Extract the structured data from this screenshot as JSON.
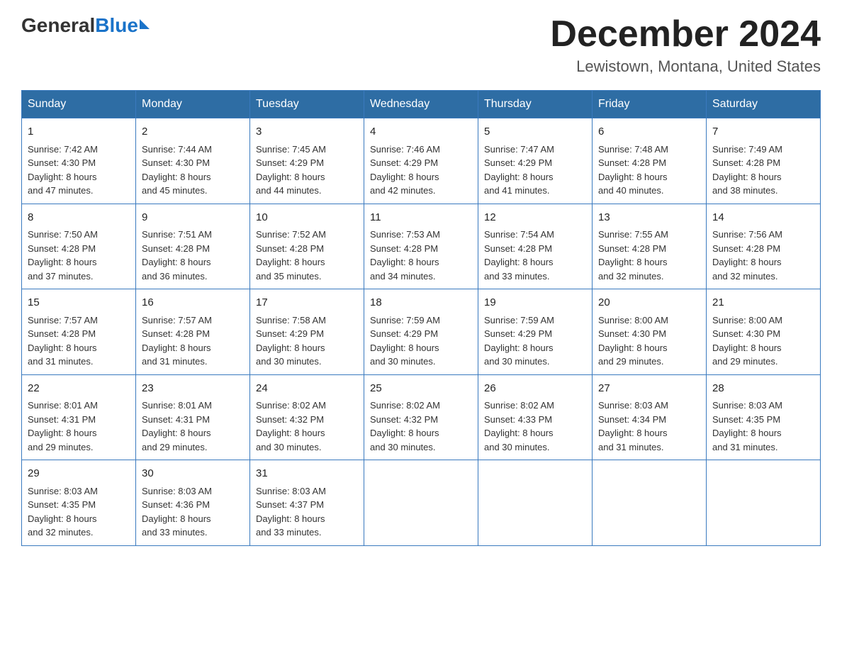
{
  "logo": {
    "general": "General",
    "blue": "Blue"
  },
  "title": "December 2024",
  "location": "Lewistown, Montana, United States",
  "days_of_week": [
    "Sunday",
    "Monday",
    "Tuesday",
    "Wednesday",
    "Thursday",
    "Friday",
    "Saturday"
  ],
  "weeks": [
    [
      {
        "day": "1",
        "sunrise": "7:42 AM",
        "sunset": "4:30 PM",
        "daylight": "8 hours and 47 minutes."
      },
      {
        "day": "2",
        "sunrise": "7:44 AM",
        "sunset": "4:30 PM",
        "daylight": "8 hours and 45 minutes."
      },
      {
        "day": "3",
        "sunrise": "7:45 AM",
        "sunset": "4:29 PM",
        "daylight": "8 hours and 44 minutes."
      },
      {
        "day": "4",
        "sunrise": "7:46 AM",
        "sunset": "4:29 PM",
        "daylight": "8 hours and 42 minutes."
      },
      {
        "day": "5",
        "sunrise": "7:47 AM",
        "sunset": "4:29 PM",
        "daylight": "8 hours and 41 minutes."
      },
      {
        "day": "6",
        "sunrise": "7:48 AM",
        "sunset": "4:28 PM",
        "daylight": "8 hours and 40 minutes."
      },
      {
        "day": "7",
        "sunrise": "7:49 AM",
        "sunset": "4:28 PM",
        "daylight": "8 hours and 38 minutes."
      }
    ],
    [
      {
        "day": "8",
        "sunrise": "7:50 AM",
        "sunset": "4:28 PM",
        "daylight": "8 hours and 37 minutes."
      },
      {
        "day": "9",
        "sunrise": "7:51 AM",
        "sunset": "4:28 PM",
        "daylight": "8 hours and 36 minutes."
      },
      {
        "day": "10",
        "sunrise": "7:52 AM",
        "sunset": "4:28 PM",
        "daylight": "8 hours and 35 minutes."
      },
      {
        "day": "11",
        "sunrise": "7:53 AM",
        "sunset": "4:28 PM",
        "daylight": "8 hours and 34 minutes."
      },
      {
        "day": "12",
        "sunrise": "7:54 AM",
        "sunset": "4:28 PM",
        "daylight": "8 hours and 33 minutes."
      },
      {
        "day": "13",
        "sunrise": "7:55 AM",
        "sunset": "4:28 PM",
        "daylight": "8 hours and 32 minutes."
      },
      {
        "day": "14",
        "sunrise": "7:56 AM",
        "sunset": "4:28 PM",
        "daylight": "8 hours and 32 minutes."
      }
    ],
    [
      {
        "day": "15",
        "sunrise": "7:57 AM",
        "sunset": "4:28 PM",
        "daylight": "8 hours and 31 minutes."
      },
      {
        "day": "16",
        "sunrise": "7:57 AM",
        "sunset": "4:28 PM",
        "daylight": "8 hours and 31 minutes."
      },
      {
        "day": "17",
        "sunrise": "7:58 AM",
        "sunset": "4:29 PM",
        "daylight": "8 hours and 30 minutes."
      },
      {
        "day": "18",
        "sunrise": "7:59 AM",
        "sunset": "4:29 PM",
        "daylight": "8 hours and 30 minutes."
      },
      {
        "day": "19",
        "sunrise": "7:59 AM",
        "sunset": "4:29 PM",
        "daylight": "8 hours and 30 minutes."
      },
      {
        "day": "20",
        "sunrise": "8:00 AM",
        "sunset": "4:30 PM",
        "daylight": "8 hours and 29 minutes."
      },
      {
        "day": "21",
        "sunrise": "8:00 AM",
        "sunset": "4:30 PM",
        "daylight": "8 hours and 29 minutes."
      }
    ],
    [
      {
        "day": "22",
        "sunrise": "8:01 AM",
        "sunset": "4:31 PM",
        "daylight": "8 hours and 29 minutes."
      },
      {
        "day": "23",
        "sunrise": "8:01 AM",
        "sunset": "4:31 PM",
        "daylight": "8 hours and 29 minutes."
      },
      {
        "day": "24",
        "sunrise": "8:02 AM",
        "sunset": "4:32 PM",
        "daylight": "8 hours and 30 minutes."
      },
      {
        "day": "25",
        "sunrise": "8:02 AM",
        "sunset": "4:32 PM",
        "daylight": "8 hours and 30 minutes."
      },
      {
        "day": "26",
        "sunrise": "8:02 AM",
        "sunset": "4:33 PM",
        "daylight": "8 hours and 30 minutes."
      },
      {
        "day": "27",
        "sunrise": "8:03 AM",
        "sunset": "4:34 PM",
        "daylight": "8 hours and 31 minutes."
      },
      {
        "day": "28",
        "sunrise": "8:03 AM",
        "sunset": "4:35 PM",
        "daylight": "8 hours and 31 minutes."
      }
    ],
    [
      {
        "day": "29",
        "sunrise": "8:03 AM",
        "sunset": "4:35 PM",
        "daylight": "8 hours and 32 minutes."
      },
      {
        "day": "30",
        "sunrise": "8:03 AM",
        "sunset": "4:36 PM",
        "daylight": "8 hours and 33 minutes."
      },
      {
        "day": "31",
        "sunrise": "8:03 AM",
        "sunset": "4:37 PM",
        "daylight": "8 hours and 33 minutes."
      },
      null,
      null,
      null,
      null
    ]
  ],
  "labels": {
    "sunrise": "Sunrise:",
    "sunset": "Sunset:",
    "daylight": "Daylight:"
  }
}
